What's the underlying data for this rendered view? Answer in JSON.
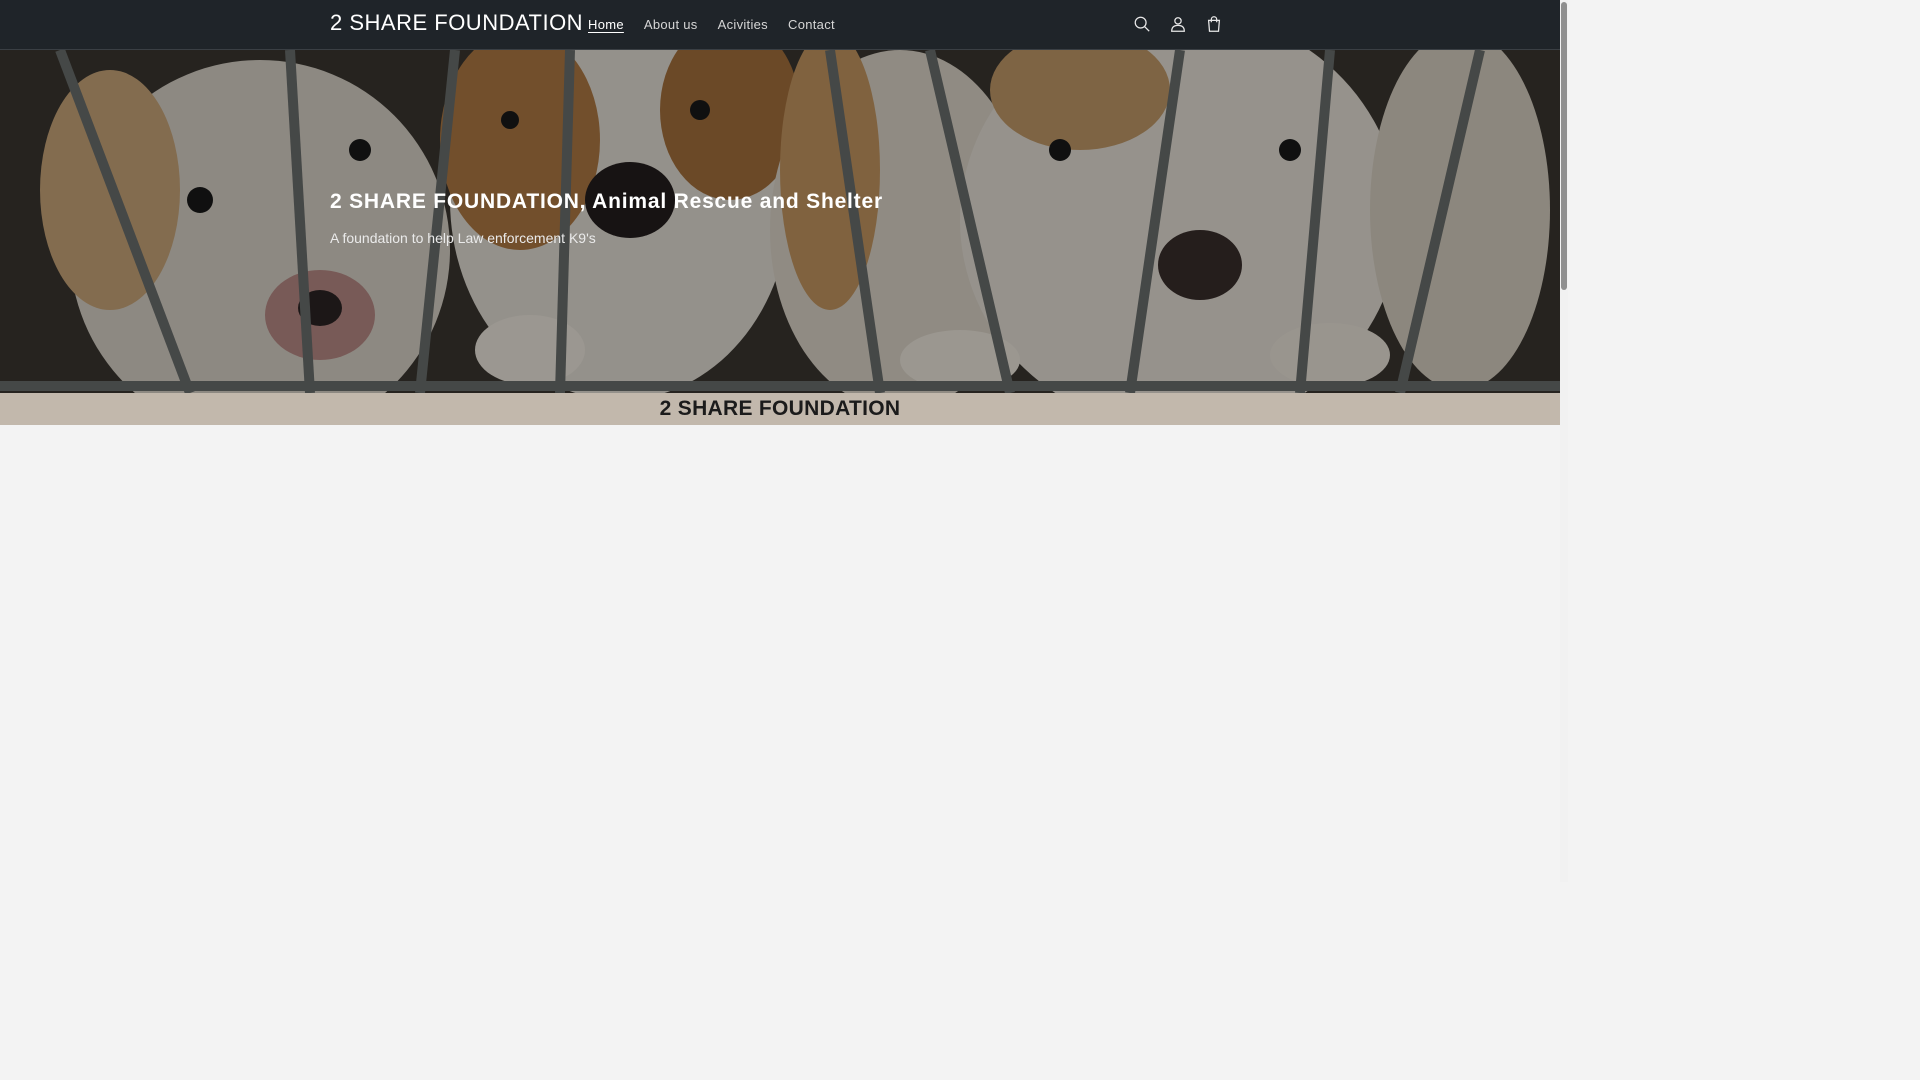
{
  "header": {
    "logo": "2 SHARE FOUNDATION",
    "nav": [
      {
        "label": "Home",
        "active": true
      },
      {
        "label": "About us",
        "active": false
      },
      {
        "label": "Acivities",
        "active": false
      },
      {
        "label": "Contact",
        "active": false
      }
    ],
    "icons": [
      "search-icon",
      "account-icon",
      "cart-icon"
    ]
  },
  "hero": {
    "title": "2 SHARE FOUNDATION, Animal Rescue and Shelter",
    "subtitle": "A foundation to help Law enforcement K9's",
    "image": "puppies-behind-cage-bars"
  },
  "band": {
    "title": "2 SHARE FOUNDATION"
  },
  "colors": {
    "header_bg": "#1f2429",
    "band_bg": "#c2b8ac",
    "page_bg": "#f3f3f3"
  }
}
